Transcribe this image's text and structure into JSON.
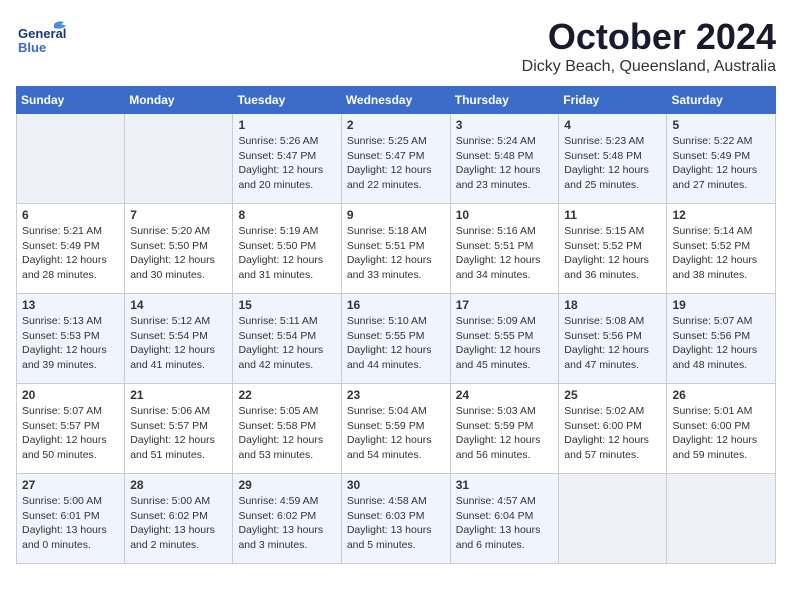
{
  "header": {
    "logo_line1": "General",
    "logo_line2": "Blue",
    "month": "October 2024",
    "location": "Dicky Beach, Queensland, Australia"
  },
  "columns": [
    "Sunday",
    "Monday",
    "Tuesday",
    "Wednesday",
    "Thursday",
    "Friday",
    "Saturday"
  ],
  "weeks": [
    [
      {
        "day": "",
        "info": ""
      },
      {
        "day": "",
        "info": ""
      },
      {
        "day": "1",
        "info": "Sunrise: 5:26 AM\nSunset: 5:47 PM\nDaylight: 12 hours and 20 minutes."
      },
      {
        "day": "2",
        "info": "Sunrise: 5:25 AM\nSunset: 5:47 PM\nDaylight: 12 hours and 22 minutes."
      },
      {
        "day": "3",
        "info": "Sunrise: 5:24 AM\nSunset: 5:48 PM\nDaylight: 12 hours and 23 minutes."
      },
      {
        "day": "4",
        "info": "Sunrise: 5:23 AM\nSunset: 5:48 PM\nDaylight: 12 hours and 25 minutes."
      },
      {
        "day": "5",
        "info": "Sunrise: 5:22 AM\nSunset: 5:49 PM\nDaylight: 12 hours and 27 minutes."
      }
    ],
    [
      {
        "day": "6",
        "info": "Sunrise: 5:21 AM\nSunset: 5:49 PM\nDaylight: 12 hours and 28 minutes."
      },
      {
        "day": "7",
        "info": "Sunrise: 5:20 AM\nSunset: 5:50 PM\nDaylight: 12 hours and 30 minutes."
      },
      {
        "day": "8",
        "info": "Sunrise: 5:19 AM\nSunset: 5:50 PM\nDaylight: 12 hours and 31 minutes."
      },
      {
        "day": "9",
        "info": "Sunrise: 5:18 AM\nSunset: 5:51 PM\nDaylight: 12 hours and 33 minutes."
      },
      {
        "day": "10",
        "info": "Sunrise: 5:16 AM\nSunset: 5:51 PM\nDaylight: 12 hours and 34 minutes."
      },
      {
        "day": "11",
        "info": "Sunrise: 5:15 AM\nSunset: 5:52 PM\nDaylight: 12 hours and 36 minutes."
      },
      {
        "day": "12",
        "info": "Sunrise: 5:14 AM\nSunset: 5:52 PM\nDaylight: 12 hours and 38 minutes."
      }
    ],
    [
      {
        "day": "13",
        "info": "Sunrise: 5:13 AM\nSunset: 5:53 PM\nDaylight: 12 hours and 39 minutes."
      },
      {
        "day": "14",
        "info": "Sunrise: 5:12 AM\nSunset: 5:54 PM\nDaylight: 12 hours and 41 minutes."
      },
      {
        "day": "15",
        "info": "Sunrise: 5:11 AM\nSunset: 5:54 PM\nDaylight: 12 hours and 42 minutes."
      },
      {
        "day": "16",
        "info": "Sunrise: 5:10 AM\nSunset: 5:55 PM\nDaylight: 12 hours and 44 minutes."
      },
      {
        "day": "17",
        "info": "Sunrise: 5:09 AM\nSunset: 5:55 PM\nDaylight: 12 hours and 45 minutes."
      },
      {
        "day": "18",
        "info": "Sunrise: 5:08 AM\nSunset: 5:56 PM\nDaylight: 12 hours and 47 minutes."
      },
      {
        "day": "19",
        "info": "Sunrise: 5:07 AM\nSunset: 5:56 PM\nDaylight: 12 hours and 48 minutes."
      }
    ],
    [
      {
        "day": "20",
        "info": "Sunrise: 5:07 AM\nSunset: 5:57 PM\nDaylight: 12 hours and 50 minutes."
      },
      {
        "day": "21",
        "info": "Sunrise: 5:06 AM\nSunset: 5:57 PM\nDaylight: 12 hours and 51 minutes."
      },
      {
        "day": "22",
        "info": "Sunrise: 5:05 AM\nSunset: 5:58 PM\nDaylight: 12 hours and 53 minutes."
      },
      {
        "day": "23",
        "info": "Sunrise: 5:04 AM\nSunset: 5:59 PM\nDaylight: 12 hours and 54 minutes."
      },
      {
        "day": "24",
        "info": "Sunrise: 5:03 AM\nSunset: 5:59 PM\nDaylight: 12 hours and 56 minutes."
      },
      {
        "day": "25",
        "info": "Sunrise: 5:02 AM\nSunset: 6:00 PM\nDaylight: 12 hours and 57 minutes."
      },
      {
        "day": "26",
        "info": "Sunrise: 5:01 AM\nSunset: 6:00 PM\nDaylight: 12 hours and 59 minutes."
      }
    ],
    [
      {
        "day": "27",
        "info": "Sunrise: 5:00 AM\nSunset: 6:01 PM\nDaylight: 13 hours and 0 minutes."
      },
      {
        "day": "28",
        "info": "Sunrise: 5:00 AM\nSunset: 6:02 PM\nDaylight: 13 hours and 2 minutes."
      },
      {
        "day": "29",
        "info": "Sunrise: 4:59 AM\nSunset: 6:02 PM\nDaylight: 13 hours and 3 minutes."
      },
      {
        "day": "30",
        "info": "Sunrise: 4:58 AM\nSunset: 6:03 PM\nDaylight: 13 hours and 5 minutes."
      },
      {
        "day": "31",
        "info": "Sunrise: 4:57 AM\nSunset: 6:04 PM\nDaylight: 13 hours and 6 minutes."
      },
      {
        "day": "",
        "info": ""
      },
      {
        "day": "",
        "info": ""
      }
    ]
  ]
}
